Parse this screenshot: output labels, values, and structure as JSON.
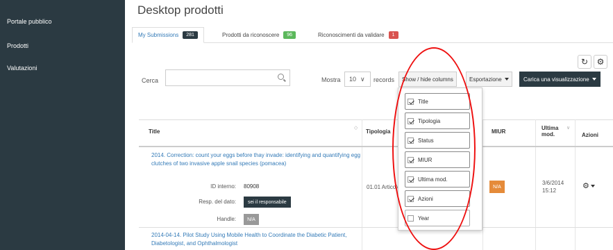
{
  "sidebar": {
    "items": [
      {
        "label": "Portale pubblico"
      },
      {
        "label": "Prodotti"
      },
      {
        "label": "Valutazioni"
      }
    ]
  },
  "page": {
    "title": "Desktop prodotti"
  },
  "tabs": [
    {
      "label": "My Submissions",
      "count": "281",
      "badge_color": "#2b3a42",
      "active": true
    },
    {
      "label": "Prodotti da riconoscere",
      "count": "96",
      "badge_color": "#5cb85c",
      "active": false
    },
    {
      "label": "Riconoscimenti da validare",
      "count": "1",
      "badge_color": "#d9534f",
      "active": false
    }
  ],
  "toolbar_icons": [
    {
      "name": "refresh-icon"
    },
    {
      "name": "gear-icon"
    }
  ],
  "controls": {
    "search_label": "Cerca",
    "search_value": "",
    "show_label": "Mostra",
    "page_size": "10",
    "records_label": "records",
    "columns_button": "Show / hide columns",
    "export_button": "Esportazione",
    "view_button": "Carica una visualizzazione"
  },
  "table": {
    "headers": {
      "title": "Title",
      "tipologia": "Tipologia",
      "miur": "MIUR",
      "ultima": "Ultima mod.",
      "azioni": "Azioni"
    },
    "rows": [
      {
        "title": "2014. Correction: count your eggs before thay invade: identifying and quantifying egg clutches of two invasive apple snail species (pomacea)",
        "id_label": "ID interno:",
        "id_value": "80908",
        "resp_label": "Resp. del dato:",
        "resp_button": "sei il responsabile",
        "handle_label": "Handle:",
        "handle_value": "N/A",
        "tipologia": "01.01 Articolo",
        "miur": "N/A",
        "ultima": "3/6/2014 15:12"
      },
      {
        "title": "2014-04-14. Pilot Study Using Mobile Health to Coordinate the Diabetic Patient, Diabetologist, and Ophthalmologist"
      }
    ]
  },
  "columns_menu": [
    {
      "label": "Title",
      "checked": true
    },
    {
      "label": "Tipologia",
      "checked": true
    },
    {
      "label": "Status",
      "checked": true
    },
    {
      "label": "MIUR",
      "checked": true
    },
    {
      "label": "Ultima mod.",
      "checked": true
    },
    {
      "label": "Azioni",
      "checked": true
    },
    {
      "label": "Year",
      "checked": false
    }
  ],
  "colors": {
    "sidebar_bg": "#2b3a42",
    "link": "#337ab7",
    "annotation": "#e11111",
    "na_orange": "#e58b3a"
  }
}
